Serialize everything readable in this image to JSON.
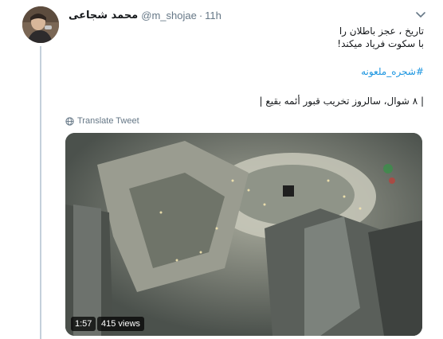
{
  "author": {
    "display_name": "محمد شجاعی",
    "handle": "@m_shojae",
    "time": "11h",
    "avatar_icon": "profile-photo"
  },
  "tweet": {
    "line1": "تاریخ ، عجز باطلان را",
    "line2": "با سکوت فریاد میکند!",
    "hashtag": "#شجره_ملعونه",
    "line3": "| ۸ شوال، سالروز تخریب قبور أئمه بقیع |"
  },
  "translate_label": "Translate Tweet",
  "video": {
    "duration": "1:57",
    "views": "415 views"
  },
  "colors": {
    "link": "#1b95e0",
    "secondary_text": "#657786",
    "thread_line": "#c4d0db"
  }
}
